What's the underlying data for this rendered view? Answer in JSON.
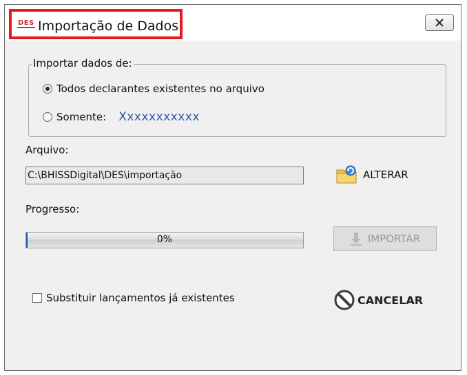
{
  "window": {
    "app_icon_text": "DES",
    "title": "Importação de Dados"
  },
  "import_group": {
    "legend": "Importar dados de:",
    "options": [
      {
        "label": "Todos declarantes existentes no arquivo",
        "checked": true
      },
      {
        "label": "Somente:",
        "checked": false,
        "value": "Xxxxxxxxxxx"
      }
    ]
  },
  "file": {
    "label": "Arquivo:",
    "path": "C:\\BHISSDigital\\DES\\importação",
    "change_button": "ALTERAR",
    "change_icon": "folder-refresh-icon"
  },
  "progress": {
    "label": "Progresso:",
    "percent_text": "0%",
    "value": 0
  },
  "import_button": {
    "label": "IMPORTAR",
    "enabled": false,
    "icon": "download-arrow-icon"
  },
  "replace_checkbox": {
    "label": "Substituir lançamentos já existentes",
    "checked": false
  },
  "cancel_button": {
    "label": "CANCELAR",
    "icon": "prohibited-icon"
  },
  "colors": {
    "highlight": "#e8171b",
    "somente_value": "#2f55a6",
    "progress_fill": "#1e57b8"
  }
}
